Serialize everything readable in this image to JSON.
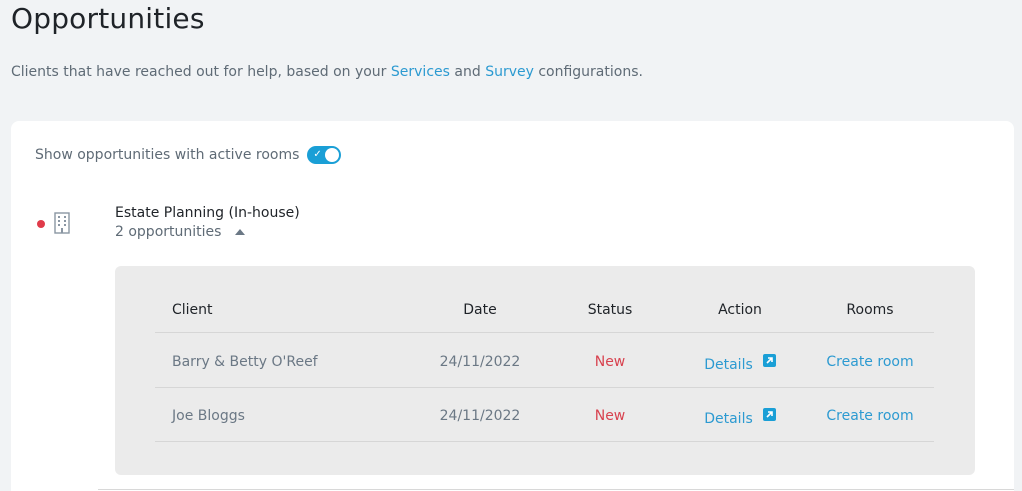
{
  "page": {
    "title": "Opportunities",
    "subtitle_pre": "Clients that have reached out for help, based on your ",
    "subtitle_link1": "Services",
    "subtitle_mid": " and ",
    "subtitle_link2": "Survey",
    "subtitle_post": " configurations."
  },
  "filter": {
    "label": "Show opportunities with active rooms",
    "toggle_on": true
  },
  "group": {
    "name": "Estate Planning (In-house)",
    "count": "2 opportunities",
    "dot_color": "#e03b4a"
  },
  "table": {
    "headers": {
      "client": "Client",
      "date": "Date",
      "status": "Status",
      "action": "Action",
      "rooms": "Rooms"
    },
    "rows": [
      {
        "client": "Barry & Betty O'Reef",
        "date": "24/11/2022",
        "status": "New",
        "action": "Details",
        "rooms": "Create room"
      },
      {
        "client": "Joe Bloggs",
        "date": "24/11/2022",
        "status": "New",
        "action": "Details",
        "rooms": "Create room"
      }
    ]
  },
  "colors": {
    "accent": "#1a9fd6",
    "link": "#2c9ad1",
    "status_new": "#d8424f"
  }
}
